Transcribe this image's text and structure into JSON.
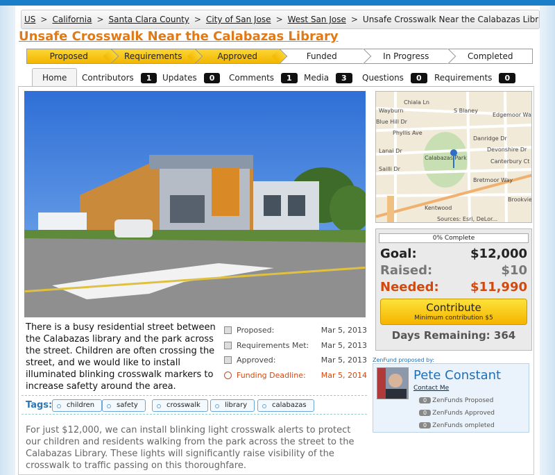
{
  "breadcrumb": {
    "items": [
      "US",
      "California",
      "Santa Clara County",
      "City of San Jose",
      "West San Jose"
    ],
    "current": "Unsafe Crosswalk Near the Calabazas Library"
  },
  "page_title": "Unsafe Crosswalk Near the Calabazas Library",
  "steps": [
    {
      "label": "Proposed",
      "done": true
    },
    {
      "label": "Requirements",
      "done": true
    },
    {
      "label": "Approved",
      "done": true
    },
    {
      "label": "Funded",
      "done": false
    },
    {
      "label": "In Progress",
      "done": false
    },
    {
      "label": "Completed",
      "done": false
    }
  ],
  "tabs": [
    {
      "label": "Home"
    },
    {
      "label": "Contributors",
      "count": "1"
    },
    {
      "label": "Updates",
      "count": "0"
    },
    {
      "label": "Comments",
      "count": "1"
    },
    {
      "label": "Media",
      "count": "3"
    },
    {
      "label": "Questions",
      "count": "0"
    },
    {
      "label": "Requirements",
      "count": "0"
    }
  ],
  "map": {
    "streets": [
      "Chiala Ln",
      "Blue Hill Dr",
      "Phyllis Ave",
      "Danridge Dr",
      "Devonshire Dr",
      "Canterbury Ct",
      "Edgemoor Way",
      "S Blaney",
      "Bretmoor Way",
      "Wayburn",
      "Lanai Dr",
      "Sailli Dr",
      "Brookview",
      "Calabazas Park",
      "Kentwood"
    ],
    "attribution": "Sources: Esri, DeLor..."
  },
  "funding": {
    "progress_text": "0% Complete",
    "progress_fraction": 0,
    "goal_label": "Goal:",
    "goal_value": "$12,000",
    "raised_label": "Raised:",
    "raised_value": "$10",
    "needed_label": "Needed:",
    "needed_value": "$11,990",
    "contribute_label": "Contribute",
    "contribute_sub": "Minimum contribution $5",
    "days_remaining": "Days Remaining: 364"
  },
  "description": "There is a busy residential street between the Calabazas library and the park across the street. Children are often crossing the street, and we would like to install illuminated blinking crosswalk markers to increase safetty around the area.",
  "dates": [
    {
      "label": "Proposed:",
      "value": "Mar 5, 2013"
    },
    {
      "label": "Requirements Met:",
      "value": "Mar 5, 2013"
    },
    {
      "label": "Approved:",
      "value": "Mar 5, 2013"
    },
    {
      "label": "Funding Deadline:",
      "value": "Mar 5, 2014"
    }
  ],
  "tags_label": "Tags:",
  "tags": [
    "children",
    "safety",
    "crosswalk",
    "library",
    "calabazas"
  ],
  "proposer": {
    "caption": "ZenFund proposed by:",
    "name": "Pete Constant",
    "contact": "Contact Me",
    "stats": [
      {
        "count": "0",
        "label": "ZenFunds Proposed"
      },
      {
        "count": "0",
        "label": "ZenFunds Approved"
      },
      {
        "count": "0",
        "label": "ZenFunds ompleted"
      }
    ]
  },
  "more_text": "For just $12,000, we can install blinking light crosswalk alerts to protect our children and residents walking from the park across the street to the Calabazas Library. These lights will significantly raise visibility of the crosswalk to traffic passing on this thoroughfare.",
  "colors": {
    "accent": "#e07a17",
    "step_done": "#f3b600",
    "link": "#1f6fb6",
    "needed": "#d04a10"
  }
}
